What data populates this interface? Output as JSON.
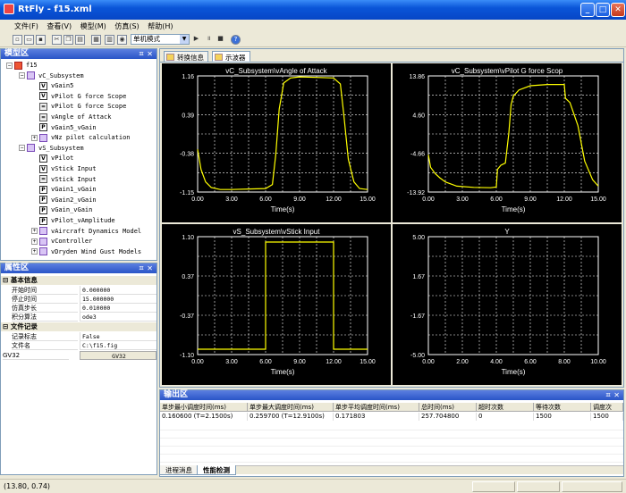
{
  "window": {
    "title": "RtFly - f15.xml"
  },
  "menu": [
    "文件(F)",
    "查看(V)",
    "模型(M)",
    "仿真(S)",
    "帮助(H)"
  ],
  "toolbar": {
    "mode": "单机模式"
  },
  "model_panel": {
    "title": "模型区",
    "pin": "ㅍ ✕",
    "tree": [
      {
        "label": "f15",
        "icon": "root",
        "indent": 0,
        "expander": "−"
      },
      {
        "label": "vC_Subsystem",
        "icon": "ss",
        "indent": 1,
        "expander": "−"
      },
      {
        "label": "vGain5",
        "icon": "v",
        "indent": 2,
        "expander": ""
      },
      {
        "label": "vPilot G force Scope",
        "icon": "v",
        "indent": 2,
        "expander": ""
      },
      {
        "label": "vPilot G force Scope",
        "icon": "eq",
        "indent": 2,
        "expander": ""
      },
      {
        "label": "vAngle of  Attack",
        "icon": "eq",
        "indent": 2,
        "expander": ""
      },
      {
        "label": "vGain5_vGain",
        "icon": "p",
        "indent": 2,
        "expander": ""
      },
      {
        "label": "vNz pilot calculation",
        "icon": "ss",
        "indent": 2,
        "expander": "+"
      },
      {
        "label": "vS_Subsystem",
        "icon": "ss",
        "indent": 1,
        "expander": "−"
      },
      {
        "label": "vPilot",
        "icon": "v",
        "indent": 2,
        "expander": ""
      },
      {
        "label": "vStick Input",
        "icon": "v",
        "indent": 2,
        "expander": ""
      },
      {
        "label": "vStick Input",
        "icon": "eq",
        "indent": 2,
        "expander": ""
      },
      {
        "label": "vGain1_vGain",
        "icon": "p",
        "indent": 2,
        "expander": ""
      },
      {
        "label": "vGain2_vGain",
        "icon": "p",
        "indent": 2,
        "expander": ""
      },
      {
        "label": "vGain_vGain",
        "icon": "p",
        "indent": 2,
        "expander": ""
      },
      {
        "label": "vPilot_vAmplitude",
        "icon": "p",
        "indent": 2,
        "expander": ""
      },
      {
        "label": "vAircraft Dynamics Model",
        "icon": "ss",
        "indent": 2,
        "expander": "+"
      },
      {
        "label": "vController",
        "icon": "ss",
        "indent": 2,
        "expander": "+"
      },
      {
        "label": "vDryden Wind Gust Models",
        "icon": "ss",
        "indent": 2,
        "expander": "+"
      }
    ]
  },
  "props_panel": {
    "title": "属性区",
    "pin": "ㅍ ✕",
    "groups": [
      {
        "name": "基本信息",
        "rows": [
          {
            "k": "开始时间",
            "v": "0.000000"
          },
          {
            "k": "停止时间",
            "v": "15.000000"
          },
          {
            "k": "仿真步长",
            "v": "0.010000"
          },
          {
            "k": "积分算法",
            "v": "ode3"
          }
        ]
      },
      {
        "name": "文件记录",
        "rows": [
          {
            "k": "记录标志",
            "v": "False"
          },
          {
            "k": "文件名",
            "v": "C:\\f15.fig"
          }
        ]
      }
    ],
    "extra": {
      "k": "GV32",
      "v": "GV32"
    }
  },
  "tabs": {
    "active": "示波器",
    "other": "转换信息"
  },
  "chart_data": [
    {
      "type": "line",
      "title": "vC_Subsystem\\vAngle of  Attack",
      "xlabel": "Time(s)",
      "xlim": [
        0,
        15
      ],
      "ylim": [
        -1.15,
        1.16
      ],
      "xticks": [
        "0.00",
        "3.00",
        "6.00",
        "9.00",
        "12.00",
        "15.00"
      ],
      "yticks": [
        "1.16",
        "0.39",
        "-0.38",
        "-1.15"
      ],
      "series": [
        {
          "x": [
            0,
            0.3,
            0.7,
            1.2,
            2.0,
            3.0,
            4.5,
            6.0,
            6.6,
            6.9,
            7.2,
            7.6,
            8.2,
            9.0,
            10.5,
            12.0,
            12.6,
            12.9,
            13.3,
            13.8,
            14.3,
            15.0
          ],
          "y": [
            -0.3,
            -0.7,
            -0.95,
            -1.06,
            -1.1,
            -1.1,
            -1.09,
            -1.08,
            -1.0,
            -0.4,
            0.5,
            1.02,
            1.12,
            1.14,
            1.13,
            1.12,
            1.0,
            0.4,
            -0.5,
            -0.95,
            -1.08,
            -1.1
          ]
        }
      ],
      "color": "#ffff00"
    },
    {
      "type": "line",
      "title": "vC_Subsystem\\vPilot G force Scop",
      "xlabel": "Time(s)",
      "xlim": [
        0,
        15
      ],
      "ylim": [
        -13.92,
        13.86
      ],
      "xticks": [
        "0.00",
        "3.00",
        "6.00",
        "9.00",
        "12.00",
        "15.00"
      ],
      "yticks": [
        "13.86",
        "4.60",
        "-4.66",
        "-13.92"
      ],
      "series": [
        {
          "x": [
            0,
            0.2,
            0.6,
            1.0,
            1.5,
            2.5,
            4.0,
            5.5,
            6.0,
            6.1,
            6.4,
            6.8,
            7.1,
            7.3,
            7.5,
            8.0,
            9.0,
            10.5,
            12.0,
            12.1,
            12.5,
            13.2,
            13.8,
            14.5,
            15.0
          ],
          "y": [
            -5.0,
            -8.0,
            -9.5,
            -10.5,
            -11.5,
            -12.5,
            -12.8,
            -12.9,
            -12.7,
            -8.5,
            -7.5,
            -7.0,
            0.0,
            7.0,
            9.0,
            10.5,
            11.5,
            11.8,
            11.8,
            8.5,
            7.5,
            2.0,
            -6.5,
            -11.0,
            -12.5
          ]
        }
      ],
      "color": "#ffff00"
    },
    {
      "type": "line",
      "title": "vS_Subsystem\\vStick Input",
      "xlabel": "Time(s)",
      "xlim": [
        0,
        15
      ],
      "ylim": [
        -1.1,
        1.1
      ],
      "xticks": [
        "0.00",
        "3.00",
        "6.00",
        "9.00",
        "12.00",
        "15.00"
      ],
      "yticks": [
        "1.10",
        "0.37",
        "-0.37",
        "-1.10"
      ],
      "series": [
        {
          "x": [
            0,
            6.0,
            6.0,
            12.0,
            12.0,
            15.0
          ],
          "y": [
            -1.0,
            -1.0,
            1.0,
            1.0,
            -1.0,
            -1.0
          ]
        }
      ],
      "color": "#ffff00"
    },
    {
      "type": "line",
      "title": "Y",
      "xlabel": "Time(s)",
      "xlim": [
        0,
        10
      ],
      "ylim": [
        -5,
        5
      ],
      "xticks": [
        "0.00",
        "2.00",
        "4.00",
        "6.00",
        "8.00",
        "10.00"
      ],
      "yticks": [
        "5.00",
        "1.67",
        "-1.67",
        "-5.00"
      ],
      "series": [],
      "color": "#ffff00"
    }
  ],
  "output_panel": {
    "title": "输出区",
    "pin": "ㅍ ✕",
    "headers": [
      "单步最小调度时间(ms)",
      "单步最大调度时间(ms)",
      "单步平均调度时间(ms)",
      "总时间(ms)",
      "超时次数",
      "等待次数",
      "调度次"
    ],
    "row": [
      "0.160600 (T=2.1500s)",
      "0.259700 (T=12.9100s)",
      "0.171803",
      "257.704800",
      "0",
      "1500",
      "1500"
    ],
    "tabs": [
      "进程消息",
      "性能检测"
    ]
  },
  "status": {
    "coords": "(13.80, 0.74)"
  }
}
